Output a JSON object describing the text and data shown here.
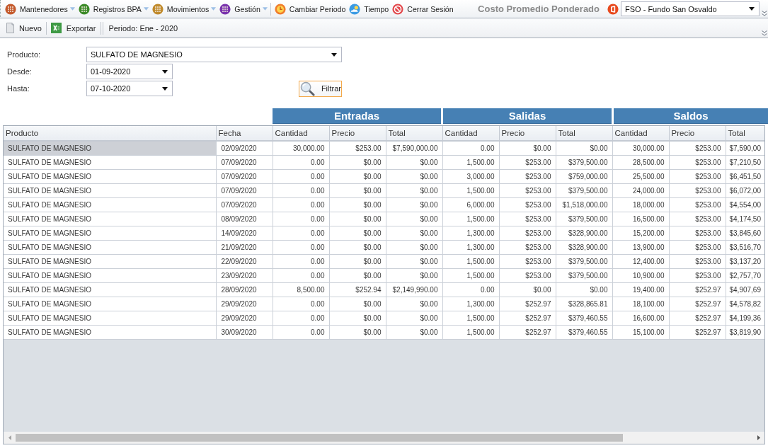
{
  "menu_bar": {
    "menus": [
      {
        "label": "Mantenedores",
        "color": "#c4592c",
        "dropdown": true
      },
      {
        "label": "Registros BPA",
        "color": "#3a8a27",
        "dropdown": true
      },
      {
        "label": "Movimientos",
        "color": "#c08a2c",
        "dropdown": true
      },
      {
        "label": "Gestión",
        "color": "#7a34ad",
        "dropdown": true
      }
    ],
    "actions": [
      {
        "label": "Cambiar Periodo",
        "kind": "clock"
      },
      {
        "label": "Tiempo",
        "kind": "weather"
      },
      {
        "label": "Cerrar Sesión",
        "kind": "logout"
      }
    ],
    "title": "Costo Promedio Ponderado",
    "company_select": {
      "value": "FSO - Fundo San Osvaldo"
    }
  },
  "toolbar": {
    "buttons": [
      {
        "label": "Nuevo",
        "kind": "new"
      },
      {
        "label": "Exportar",
        "kind": "export"
      }
    ],
    "period": "Periodo: Ene - 2020"
  },
  "filters": {
    "product": {
      "label": "Producto:",
      "value": "SULFATO DE MAGNESIO"
    },
    "date_from": {
      "label": "Desde:",
      "value": "01-09-2020"
    },
    "date_to": {
      "label": "Hasta:",
      "value": "07-10-2020"
    },
    "filter_button": {
      "label": "Filtrar",
      "focused": true
    }
  },
  "table": {
    "groups": [
      "Entradas",
      "Salidas",
      "Saldos"
    ],
    "columns": [
      "Producto",
      "Fecha",
      "Cantidad",
      "Precio",
      "Total",
      "Cantidad",
      "Precio",
      "Total",
      "Cantidad",
      "Precio",
      "Total"
    ],
    "rows": [
      {
        "selected": true,
        "cells": [
          "SULFATO DE MAGNESIO",
          "02/09/2020",
          "30,000.00",
          "$253.00",
          "$7,590,000.00",
          "0.00",
          "$0.00",
          "$0.00",
          "30,000.00",
          "$253.00",
          "$7,590,00"
        ]
      },
      {
        "selected": false,
        "cells": [
          "SULFATO DE MAGNESIO",
          "07/09/2020",
          "0.00",
          "$0.00",
          "$0.00",
          "1,500.00",
          "$253.00",
          "$379,500.00",
          "28,500.00",
          "$253.00",
          "$7,210,50"
        ]
      },
      {
        "selected": false,
        "cells": [
          "SULFATO DE MAGNESIO",
          "07/09/2020",
          "0.00",
          "$0.00",
          "$0.00",
          "3,000.00",
          "$253.00",
          "$759,000.00",
          "25,500.00",
          "$253.00",
          "$6,451,50"
        ]
      },
      {
        "selected": false,
        "cells": [
          "SULFATO DE MAGNESIO",
          "07/09/2020",
          "0.00",
          "$0.00",
          "$0.00",
          "1,500.00",
          "$253.00",
          "$379,500.00",
          "24,000.00",
          "$253.00",
          "$6,072,00"
        ]
      },
      {
        "selected": false,
        "cells": [
          "SULFATO DE MAGNESIO",
          "07/09/2020",
          "0.00",
          "$0.00",
          "$0.00",
          "6,000.00",
          "$253.00",
          "$1,518,000.00",
          "18,000.00",
          "$253.00",
          "$4,554,00"
        ]
      },
      {
        "selected": false,
        "cells": [
          "SULFATO DE MAGNESIO",
          "08/09/2020",
          "0.00",
          "$0.00",
          "$0.00",
          "1,500.00",
          "$253.00",
          "$379,500.00",
          "16,500.00",
          "$253.00",
          "$4,174,50"
        ]
      },
      {
        "selected": false,
        "cells": [
          "SULFATO DE MAGNESIO",
          "14/09/2020",
          "0.00",
          "$0.00",
          "$0.00",
          "1,300.00",
          "$253.00",
          "$328,900.00",
          "15,200.00",
          "$253.00",
          "$3,845,60"
        ]
      },
      {
        "selected": false,
        "cells": [
          "SULFATO DE MAGNESIO",
          "21/09/2020",
          "0.00",
          "$0.00",
          "$0.00",
          "1,300.00",
          "$253.00",
          "$328,900.00",
          "13,900.00",
          "$253.00",
          "$3,516,70"
        ]
      },
      {
        "selected": false,
        "cells": [
          "SULFATO DE MAGNESIO",
          "22/09/2020",
          "0.00",
          "$0.00",
          "$0.00",
          "1,500.00",
          "$253.00",
          "$379,500.00",
          "12,400.00",
          "$253.00",
          "$3,137,20"
        ]
      },
      {
        "selected": false,
        "cells": [
          "SULFATO DE MAGNESIO",
          "23/09/2020",
          "0.00",
          "$0.00",
          "$0.00",
          "1,500.00",
          "$253.00",
          "$379,500.00",
          "10,900.00",
          "$253.00",
          "$2,757,70"
        ]
      },
      {
        "selected": false,
        "cells": [
          "SULFATO DE MAGNESIO",
          "28/09/2020",
          "8,500.00",
          "$252.94",
          "$2,149,990.00",
          "0.00",
          "$0.00",
          "$0.00",
          "19,400.00",
          "$252.97",
          "$4,907,69"
        ]
      },
      {
        "selected": false,
        "cells": [
          "SULFATO DE MAGNESIO",
          "29/09/2020",
          "0.00",
          "$0.00",
          "$0.00",
          "1,300.00",
          "$252.97",
          "$328,865.81",
          "18,100.00",
          "$252.97",
          "$4,578,82"
        ]
      },
      {
        "selected": false,
        "cells": [
          "SULFATO DE MAGNESIO",
          "29/09/2020",
          "0.00",
          "$0.00",
          "$0.00",
          "1,500.00",
          "$252.97",
          "$379,460.55",
          "16,600.00",
          "$252.97",
          "$4,199,36"
        ]
      },
      {
        "selected": false,
        "cells": [
          "SULFATO DE MAGNESIO",
          "30/09/2020",
          "0.00",
          "$0.00",
          "$0.00",
          "1,500.00",
          "$252.97",
          "$379,460.55",
          "15,100.00",
          "$252.97",
          "$3,819,90"
        ]
      }
    ]
  }
}
